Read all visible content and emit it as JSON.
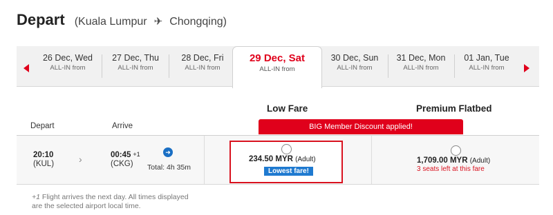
{
  "header": {
    "title": "Depart",
    "route_open": "(Kuala Lumpur",
    "route_plane": "✈",
    "route_close": "Chongqing)"
  },
  "date_tabs": [
    {
      "date": "26 Dec, Wed",
      "sub": "ALL-IN from"
    },
    {
      "date": "27 Dec, Thu",
      "sub": "ALL-IN from"
    },
    {
      "date": "28 Dec, Fri",
      "sub": "ALL-IN from"
    },
    {
      "date": "29 Dec, Sat",
      "sub": "ALL-IN from",
      "active": true
    },
    {
      "date": "30 Dec, Sun",
      "sub": "ALL-IN from"
    },
    {
      "date": "31 Dec, Mon",
      "sub": "ALL-IN from"
    },
    {
      "date": "01 Jan, Tue",
      "sub": "ALL-IN from"
    }
  ],
  "columns": {
    "low_fare": "Low Fare",
    "premium": "Premium Flatbed",
    "depart": "Depart",
    "arrive": "Arrive"
  },
  "promo": "BIG Member Discount applied!",
  "flight": {
    "depart_time": "20:10",
    "depart_code": "(KUL)",
    "arrive_time": "00:45",
    "arrive_plus": "+1",
    "arrive_code": "(CKG)",
    "total": "Total: 4h 35m"
  },
  "fares": {
    "low": {
      "price": "234.50 MYR",
      "unit": "(Adult)",
      "badge": "Lowest fare!"
    },
    "premium": {
      "price": "1,709.00 MYR",
      "unit": "(Adult)",
      "note": "3 seats left at this fare"
    }
  },
  "footnote": {
    "plus": "+1",
    "line1_rest": " Flight arrives the next day. All times displayed",
    "line2": "are the selected airport local time."
  },
  "colors": {
    "brand_red": "#e0001b",
    "badge_blue": "#1f7ad0"
  }
}
